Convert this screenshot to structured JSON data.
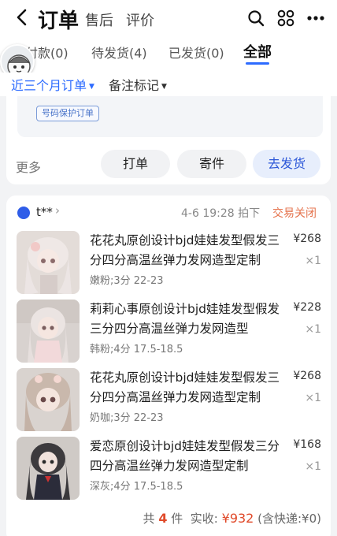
{
  "header": {
    "title": "订单",
    "tabs": [
      "售后",
      "评价"
    ]
  },
  "order_tabs": [
    {
      "label": "付款(0)"
    },
    {
      "label": "待发货(4)"
    },
    {
      "label": "已发货(0)"
    },
    {
      "label": "全部"
    }
  ],
  "filters": {
    "period": "近三个月订单",
    "note": "备注标记"
  },
  "previous_order": {
    "protect_tag": "号码保护订单",
    "more": "更多",
    "actions": [
      "打单",
      "寄件",
      "去发货"
    ]
  },
  "order": {
    "shop_name": "t**",
    "time": "4-6 19:28 拍下",
    "status": "交易关闭",
    "items": [
      {
        "title": "花花丸原创设计bjd娃娃发型假发三分四分高温丝弹力发网造型定制",
        "spec": "嫩粉;3分 22-23",
        "price": "¥268",
        "qty": "×1"
      },
      {
        "title": "莉莉心事原创设计bjd娃娃发型假发三分四分高温丝弹力发网造型",
        "spec": "韩粉;4分 17.5-18.5",
        "price": "¥228",
        "qty": "×1"
      },
      {
        "title": "花花丸原创设计bjd娃娃发型假发三分四分高温丝弹力发网造型定制",
        "spec": "奶咖;3分 22-23",
        "price": "¥268",
        "qty": "×1"
      },
      {
        "title": "爱恋原创设计bjd娃娃发型假发三分四分高温丝弹力发网造型定制",
        "spec": "深灰;4分 17.5-18.5",
        "price": "¥168",
        "qty": "×1"
      }
    ],
    "summary": {
      "count_prefix": "共",
      "count": "4",
      "count_suffix": "件",
      "paid_label": "实收:",
      "paid_amount": "¥932",
      "shipping_note": "(含快递:¥0)"
    }
  },
  "colors": {
    "accent": "#2d6bff",
    "status": "#e5734d",
    "price": "#e04a2a"
  }
}
